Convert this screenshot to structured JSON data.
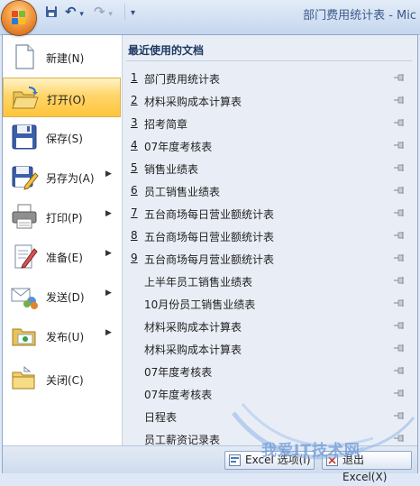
{
  "window": {
    "title": "部门费用统计表 - Mic"
  },
  "quick_access": {
    "undo_glyph": "↶",
    "redo_glyph": "↷",
    "dropdown_glyph": "▾",
    "customize_glyph": "▾"
  },
  "menu": {
    "items": [
      {
        "label": "新建(N)",
        "icon": "new-document-icon",
        "has_submenu": false
      },
      {
        "label": "打开(O)",
        "icon": "open-folder-icon",
        "has_submenu": false,
        "active": true
      },
      {
        "label": "保存(S)",
        "icon": "save-disk-icon",
        "has_submenu": false
      },
      {
        "label": "另存为(A)",
        "icon": "save-as-icon",
        "has_submenu": true
      },
      {
        "label": "打印(P)",
        "icon": "printer-icon",
        "has_submenu": true
      },
      {
        "label": "准备(E)",
        "icon": "prepare-icon",
        "has_submenu": true
      },
      {
        "label": "发送(D)",
        "icon": "send-icon",
        "has_submenu": true
      },
      {
        "label": "发布(U)",
        "icon": "publish-icon",
        "has_submenu": true
      },
      {
        "label": "关闭(C)",
        "icon": "close-folder-icon",
        "has_submenu": false
      }
    ],
    "submenu_arrow": "▶"
  },
  "recent": {
    "heading": "最近使用的文档",
    "documents": [
      {
        "num": "1",
        "name": "部门费用统计表"
      },
      {
        "num": "2",
        "name": "材料采购成本计算表"
      },
      {
        "num": "3",
        "name": "招考简章"
      },
      {
        "num": "4",
        "name": "07年度考核表"
      },
      {
        "num": "5",
        "name": "销售业绩表"
      },
      {
        "num": "6",
        "name": "员工销售业绩表"
      },
      {
        "num": "7",
        "name": "五台商场每日营业额统计表"
      },
      {
        "num": "8",
        "name": "五台商场每日营业额统计表"
      },
      {
        "num": "9",
        "name": "五台商场每月营业额统计表"
      },
      {
        "num": "",
        "name": "上半年员工销售业绩表"
      },
      {
        "num": "",
        "name": "10月份员工销售业绩表"
      },
      {
        "num": "",
        "name": "材料采购成本计算表"
      },
      {
        "num": "",
        "name": "材料采购成本计算表"
      },
      {
        "num": "",
        "name": "07年度考核表"
      },
      {
        "num": "",
        "name": "07年度考核表"
      },
      {
        "num": "",
        "name": "日程表"
      },
      {
        "num": "",
        "name": "员工薪资记录表"
      }
    ]
  },
  "footer": {
    "options_label": "Excel 选项(I)",
    "exit_label": "退出 Excel(X)"
  },
  "watermark": {
    "text": "我爱IT技术网"
  }
}
